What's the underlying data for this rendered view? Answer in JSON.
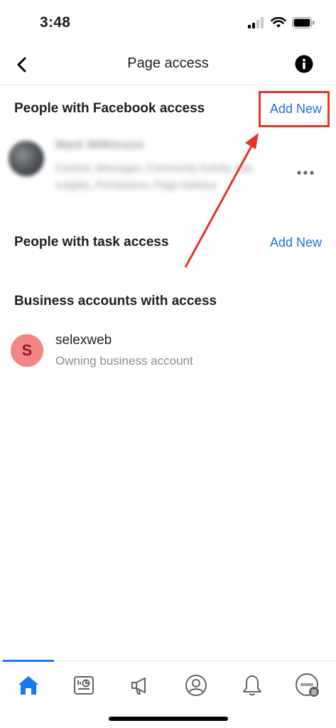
{
  "status_bar": {
    "time": "3:48"
  },
  "nav": {
    "title": "Page access"
  },
  "sections": {
    "facebook_access": {
      "title": "People with Facebook access",
      "add_label": "Add New"
    },
    "task_access": {
      "title": "People with task access",
      "add_label": "Add New"
    },
    "business_access": {
      "title": "Business accounts with access"
    }
  },
  "blurred_person": {
    "name": "Mark Wilkinson",
    "description": "Content, Messages, Community Activity, Ads, Insights, Permissions, Page Deletion"
  },
  "business_account": {
    "avatar_letter": "S",
    "name": "selexweb",
    "subtitle": "Owning business account"
  },
  "tabs": [
    {
      "icon": "home-icon",
      "active": true
    },
    {
      "icon": "insights-icon",
      "active": false
    },
    {
      "icon": "megaphone-icon",
      "active": false
    },
    {
      "icon": "profile-icon",
      "active": false
    },
    {
      "icon": "bell-icon",
      "active": false
    },
    {
      "icon": "page-avatar-icon",
      "active": false
    }
  ],
  "colors": {
    "link_blue": "#1a73e8",
    "active_tab": "#1877f2",
    "annotation_red": "#e53524",
    "avatar_bg": "#f48686"
  }
}
